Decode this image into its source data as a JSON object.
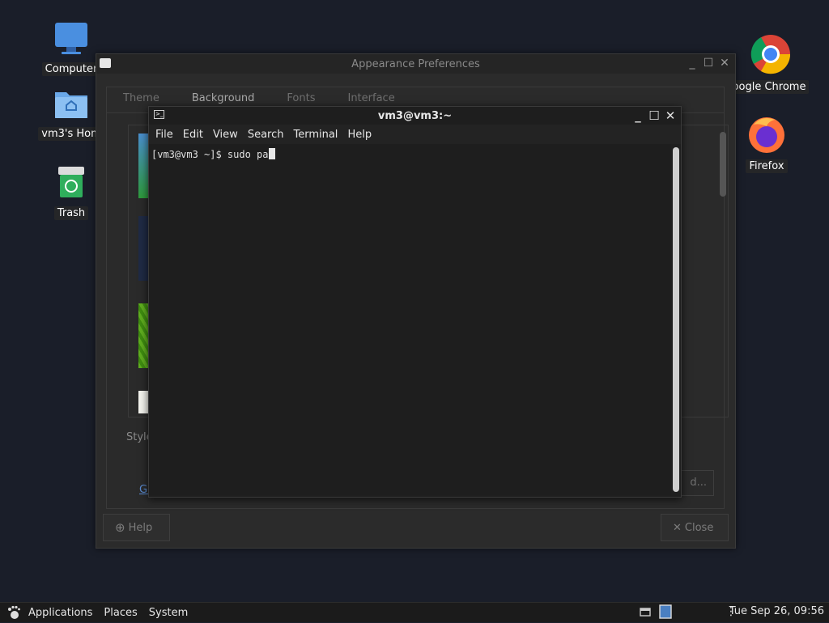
{
  "desktop": {
    "icons": [
      {
        "label": "Computer"
      },
      {
        "label": "vm3's Hom"
      },
      {
        "label": "Trash"
      },
      {
        "label": "oogle Chrome"
      },
      {
        "label": "Firefox"
      }
    ]
  },
  "appearance": {
    "title": "Appearance Preferences",
    "tabs": [
      "Theme",
      "Background",
      "Fonts",
      "Interface"
    ],
    "style_label": "Style:",
    "get_link": "Get",
    "add_button": "d...",
    "help_button": "Help",
    "close_button": "Close"
  },
  "terminal": {
    "title": "vm3@vm3:~",
    "menu": [
      "File",
      "Edit",
      "View",
      "Search",
      "Terminal",
      "Help"
    ],
    "prompt": "[vm3@vm3 ~]$ ",
    "command": "sudo pa"
  },
  "panel": {
    "applications": "Applications",
    "places": "Places",
    "system": "System",
    "clock": "Tue Sep 26, 09:56"
  },
  "colors": {
    "desktop_bg": "#1a1e29",
    "terminal_bg": "#1e1e1e",
    "link": "#5a8bd1"
  }
}
